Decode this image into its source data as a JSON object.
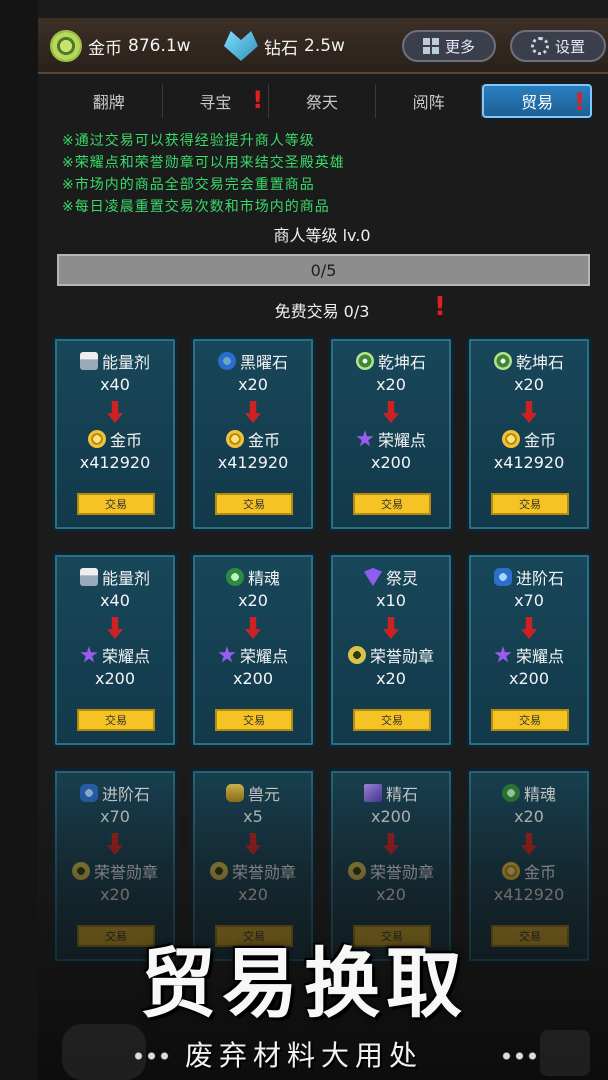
{
  "resources": {
    "gold_label": "金币",
    "gold_value": "876.1w",
    "diamond_label": "钻石",
    "diamond_value": "2.5w"
  },
  "top_buttons": {
    "more_label": "更多",
    "settings_label": "设置"
  },
  "tabs": [
    {
      "label": "翻牌",
      "alert": false,
      "active": false
    },
    {
      "label": "寻宝",
      "alert": true,
      "active": false
    },
    {
      "label": "祭天",
      "alert": false,
      "active": false
    },
    {
      "label": "阅阵",
      "alert": false,
      "active": false
    },
    {
      "label": "贸易",
      "alert": true,
      "active": true
    }
  ],
  "notes": [
    "※通过交易可以获得经验提升商人等级",
    "※荣耀点和荣誉勋章可以用来结交圣殿英雄",
    "※市场内的商品全部交易完会重置商品",
    "※每日凌晨重置交易次数和市场内的商品"
  ],
  "merchant": {
    "level_text": "商人等级 lv.0",
    "progress_text": "0/5",
    "progress_fraction": 0.0,
    "free_trade_text": "免费交易 0/3",
    "alert_mark": "!"
  },
  "trade_button_label": "交易",
  "cards": [
    {
      "give_icon": "potion-icon",
      "give_name": "能量剂",
      "give_qty": "x40",
      "get_icon": "gold-coin-icon",
      "get_name": "金币",
      "get_qty": "x412920"
    },
    {
      "give_icon": "obsidian-icon",
      "give_name": "黑曜石",
      "give_qty": "x20",
      "get_icon": "gold-coin-icon",
      "get_name": "金币",
      "get_qty": "x412920"
    },
    {
      "give_icon": "qiankun-stone-icon",
      "give_name": "乾坤石",
      "give_qty": "x20",
      "get_icon": "glory-star-icon",
      "get_name": "荣耀点",
      "get_qty": "x200"
    },
    {
      "give_icon": "qiankun-stone-icon",
      "give_name": "乾坤石",
      "give_qty": "x20",
      "get_icon": "gold-coin-icon",
      "get_name": "金币",
      "get_qty": "x412920"
    },
    {
      "give_icon": "potion-icon",
      "give_name": "能量剂",
      "give_qty": "x40",
      "get_icon": "glory-star-icon",
      "get_name": "荣耀点",
      "get_qty": "x200"
    },
    {
      "give_icon": "soul-icon",
      "give_name": "精魂",
      "give_qty": "x20",
      "get_icon": "glory-star-icon",
      "get_name": "荣耀点",
      "get_qty": "x200"
    },
    {
      "give_icon": "sacrifice-spirit-icon",
      "give_name": "祭灵",
      "give_qty": "x10",
      "get_icon": "honor-medal-icon",
      "get_name": "荣誉勋章",
      "get_qty": "x20"
    },
    {
      "give_icon": "advance-stone-icon",
      "give_name": "进阶石",
      "give_qty": "x70",
      "get_icon": "glory-star-icon",
      "get_name": "荣耀点",
      "get_qty": "x200"
    },
    {
      "give_icon": "advance-stone-icon",
      "give_name": "进阶石",
      "give_qty": "x70",
      "get_icon": "honor-medal-icon",
      "get_name": "荣誉勋章",
      "get_qty": "x20"
    },
    {
      "give_icon": "beast-essence-icon",
      "give_name": "兽元",
      "give_qty": "x5",
      "get_icon": "honor-medal-icon",
      "get_name": "荣誉勋章",
      "get_qty": "x20"
    },
    {
      "give_icon": "refined-stone-icon",
      "give_name": "精石",
      "give_qty": "x200",
      "get_icon": "honor-medal-icon",
      "get_name": "荣誉勋章",
      "get_qty": "x20"
    },
    {
      "give_icon": "soul-icon",
      "give_name": "精魂",
      "give_qty": "x20",
      "get_icon": "gold-coin-icon",
      "get_name": "金币",
      "get_qty": "x412920"
    }
  ],
  "promo": {
    "headline": "贸易换取",
    "subline": "废弃材料大用处"
  },
  "colors": {
    "notes_green": "#39d96a",
    "card_bg": "#18475a",
    "trade_button": "#f5c323",
    "active_tab": "#2a7fbf",
    "alert_red": "#e02020"
  }
}
